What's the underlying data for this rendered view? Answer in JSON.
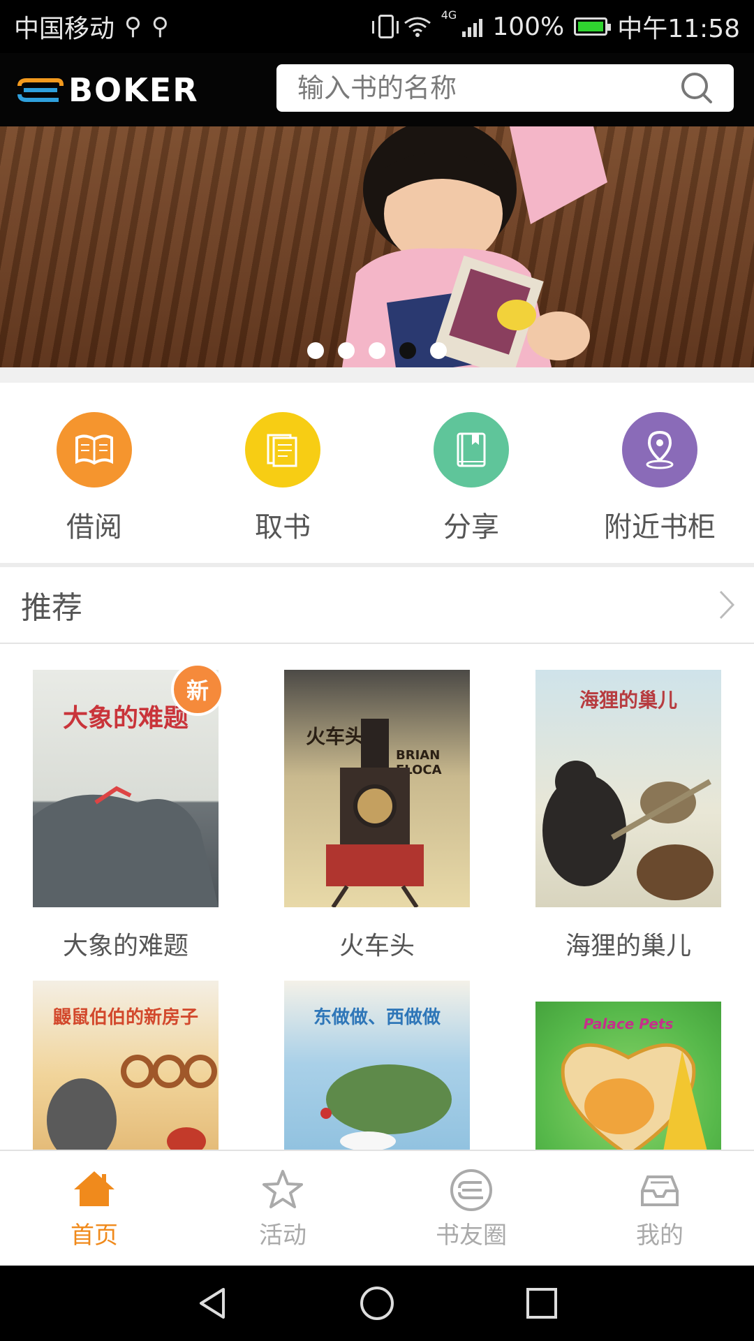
{
  "status_bar": {
    "carrier": "中国移动",
    "network": "4G",
    "battery": "100%",
    "time": "中午11:58"
  },
  "header": {
    "logo_text": "BOKER",
    "search_placeholder": "输入书的名称"
  },
  "banner": {
    "dots_total": 5,
    "active_dot": 4
  },
  "quick_actions": [
    {
      "label": "借阅",
      "icon": "open-book-icon",
      "color": "#f5952e"
    },
    {
      "label": "取书",
      "icon": "documents-icon",
      "color": "#f7cd14"
    },
    {
      "label": "分享",
      "icon": "book-share-icon",
      "color": "#5fc59a"
    },
    {
      "label": "附近书柜",
      "icon": "location-pin-icon",
      "color": "#8a6bb8"
    }
  ],
  "recommended": {
    "title": "推荐",
    "books": [
      {
        "title": "大象的难题",
        "cover_text": "大象的难题",
        "badge": "新"
      },
      {
        "title": "火车头",
        "cover_text": "火车头",
        "cover_subtext": "BRIAN FLOCA"
      },
      {
        "title": "海狸的巢儿",
        "cover_text": "海狸的巢儿"
      },
      {
        "title": "",
        "cover_text": "鼹鼠伯伯的新房子"
      },
      {
        "title": "",
        "cover_text": "东做做、西做做"
      },
      {
        "title": "",
        "cover_text": "Palace Pets"
      }
    ]
  },
  "bottom_nav": [
    {
      "label": "首页",
      "icon": "home-icon",
      "active": true
    },
    {
      "label": "活动",
      "icon": "star-icon",
      "active": false
    },
    {
      "label": "书友圈",
      "icon": "boker-circle-icon",
      "active": false
    },
    {
      "label": "我的",
      "icon": "inbox-tray-icon",
      "active": false
    }
  ],
  "colors": {
    "accent": "#f08a1c",
    "inactive": "#aaaaaa"
  }
}
